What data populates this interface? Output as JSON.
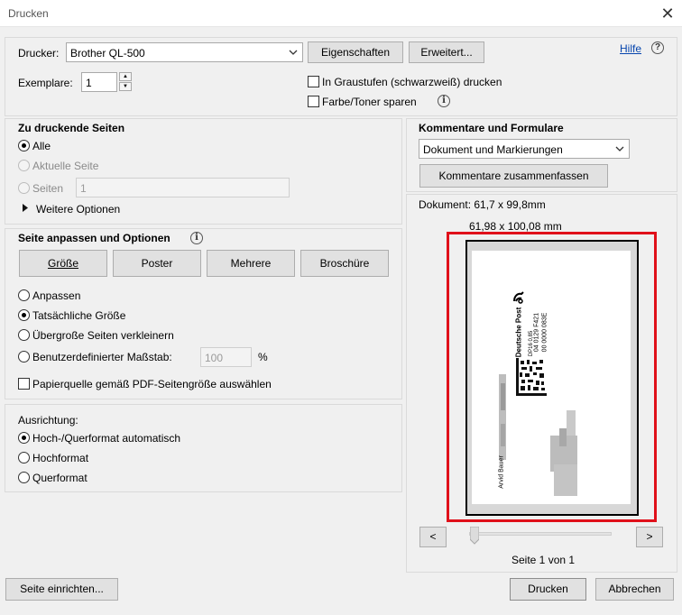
{
  "window": {
    "title": "Drucken",
    "close_glyph": "✕"
  },
  "printer": {
    "label": "Drucker:",
    "selected": "Brother QL-500",
    "properties_button": "Eigenschaften",
    "advanced_button": "Erweitert...",
    "help_link": "Hilfe",
    "copies_label": "Exemplare:",
    "copies_value": "1",
    "grayscale_label": "In Graustufen (schwarzweiß) drucken",
    "save_toner_label": "Farbe/Toner sparen"
  },
  "pages": {
    "heading": "Zu druckende Seiten",
    "option_all": "Alle",
    "option_current": "Aktuelle Seite",
    "option_pages": "Seiten",
    "pages_value": "1",
    "more_options": "Weitere Optionen"
  },
  "sizing": {
    "heading": "Seite anpassen und Optionen",
    "tab_size": "Größe",
    "tab_poster": "Poster",
    "tab_multiple": "Mehrere",
    "tab_booklet": "Broschüre",
    "option_fit": "Anpassen",
    "option_actual": "Tatsächliche Größe",
    "option_shrink": "Übergroße Seiten verkleinern",
    "option_custom": "Benutzerdefinierter Maßstab:",
    "custom_value": "100",
    "custom_unit": "%",
    "paper_source": "Papierquelle gemäß PDF-Seitengröße auswählen"
  },
  "orientation": {
    "heading": "Ausrichtung:",
    "option_auto": "Hoch-/Querformat automatisch",
    "option_portrait": "Hochformat",
    "option_landscape": "Querformat"
  },
  "comments": {
    "heading": "Kommentare und Formulare",
    "selected": "Dokument und Markierungen",
    "summarize_button": "Kommentare zusammenfassen"
  },
  "preview": {
    "document_size": "Dokument: 61,7 x 99,8mm",
    "paper_size": "61,98 x 100,08 mm",
    "label_brand": "Deutsche Post",
    "label_sender": "Arvid Bauer",
    "label_code_1": "04 0129 F421",
    "label_code_2": "00 0000 083E",
    "label_code_3": "DP16 0,85",
    "prev_button": "<",
    "next_button": ">",
    "page_status": "Seite 1 von 1"
  },
  "footer": {
    "page_setup_button": "Seite einrichten...",
    "print_button": "Drucken",
    "cancel_button": "Abbrechen"
  }
}
